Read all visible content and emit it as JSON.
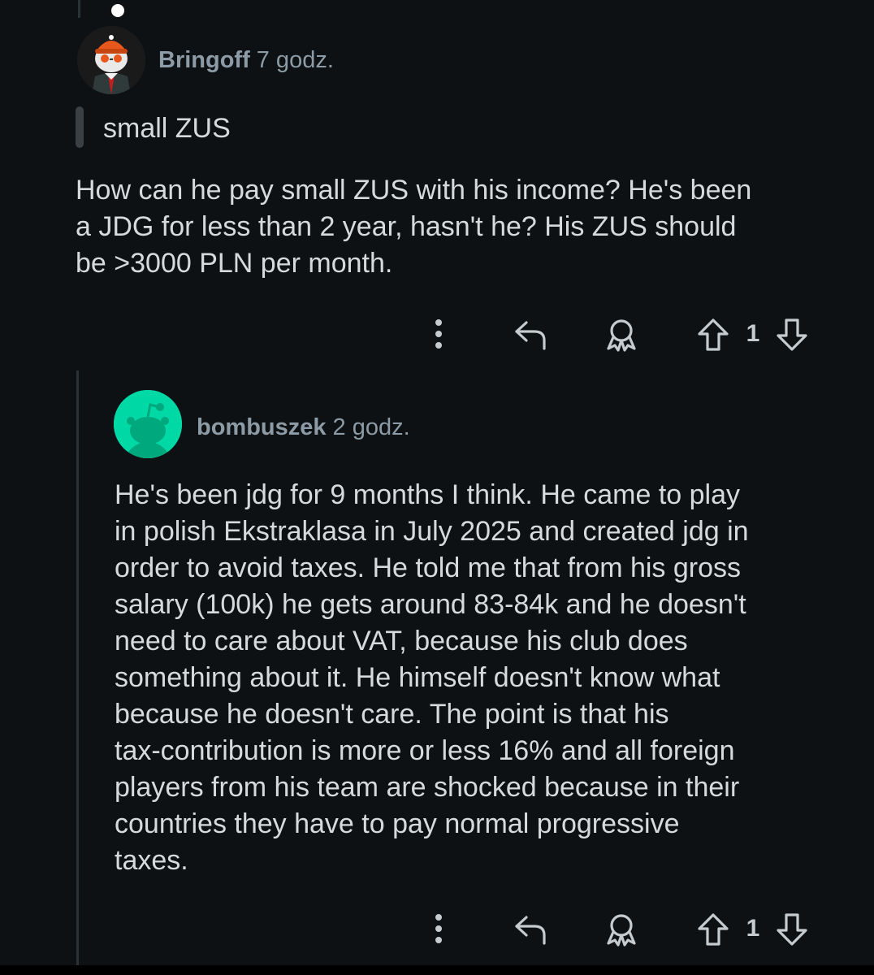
{
  "comment": {
    "username": "Bringoff",
    "time": "7 godz.",
    "quote": "small ZUS",
    "body_lines": [
      "How can he pay small ZUS with his income? He's been",
      "a JDG for less than 2 year, hasn't he? His ZUS should",
      "be >3000 PLN per month."
    ],
    "score": "1"
  },
  "reply": {
    "username": "bombuszek",
    "time": "2 godz.",
    "body_lines": [
      "He's been jdg for 9 months I think. He came to play",
      "in polish Ekstraklasa in July 2025 and created jdg in",
      "order to avoid taxes. He told me that from his gross",
      "salary (100k) he gets around 83-84k and he doesn't",
      "need to care about VAT, because his club does",
      "something about it. He himself doesn't know what",
      "because he doesn't care. The point is that his",
      "tax-contribution is more or less 16% and all foreign",
      "players from his team are shocked because in their",
      "countries they have to pay normal progressive",
      "taxes."
    ],
    "score": "1"
  },
  "icons": [
    "more-options-icon",
    "reply-icon",
    "award-icon",
    "upvote-icon",
    "downvote-icon"
  ],
  "colors": {
    "background": "#0e1113",
    "text": "#d7dadc",
    "meta": "#8c9ba5",
    "reply_avatar": "#00d9a5",
    "avatar_helmet": "#e8581c"
  }
}
